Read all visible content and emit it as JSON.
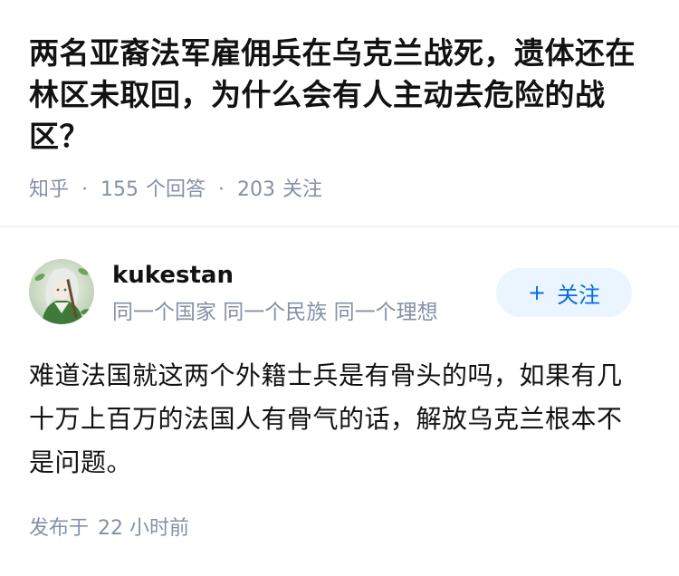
{
  "question": {
    "title": "两名亚裔法军雇佣兵在乌克兰战死，遗体还在林区未取回，为什么会有人主动去危险的战区？",
    "source": "知乎",
    "separator": "·",
    "answers_count": "155",
    "answers_label": "个回答",
    "followers_count": "203",
    "followers_label": "关注"
  },
  "answer": {
    "author": {
      "name": "kukestan",
      "bio": "同一个国家 同一个民族 同一个理想"
    },
    "follow_button": {
      "icon": "plus-icon",
      "label": "关注"
    },
    "content": "难道法国就这两个外籍士兵是有骨头的吗，如果有几十万上百万的法国人有骨气的话，解放乌克兰根本不是问题。",
    "published_label": "发布于",
    "published_time": "22 小时前"
  },
  "colors": {
    "accent": "#056de8",
    "accent_bg": "#ebf5ff",
    "meta_text": "#8590a6",
    "main_text": "#121212"
  }
}
